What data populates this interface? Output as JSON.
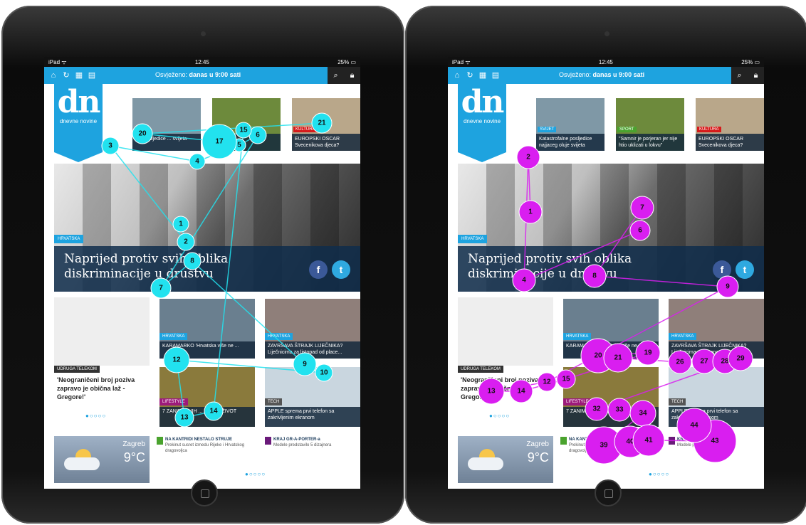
{
  "status_bar": {
    "device": "iPad ᯤ",
    "time": "12:45",
    "battery": "25% ▭"
  },
  "toolbar": {
    "refresh_prefix": "Osvježeno:",
    "refresh_value": "danas u 9:00 sati",
    "icons": [
      "home-icon",
      "refresh-icon",
      "grid-icon",
      "newspaper-icon",
      "search-icon",
      "lock-icon"
    ]
  },
  "logo": {
    "text": "dn",
    "subtitle": "dnevne novine"
  },
  "screen_left": {
    "top_thumbs": [
      {
        "tag": "",
        "caption": "...e posljedice ... svijeta"
      },
      {
        "tag": "",
        "caption": ""
      },
      {
        "tag": "KULTURA",
        "caption": "EUROPSKI OSCAR Svecenikova djeca?"
      }
    ]
  },
  "screen_right": {
    "top_thumbs": [
      {
        "tag": "SVIJET",
        "caption": "Katastrofalne posljedice najjaceg oluje svijeta"
      },
      {
        "tag": "SPORT",
        "caption": "\"Samnir je porjeran jer nije htio uklizati u lokvu\""
      },
      {
        "tag": "KULTURA",
        "caption": "EUROPSKI OSCAR Svecenikova djeca?"
      }
    ]
  },
  "hero": {
    "tag": "HRVATSKA",
    "title_line1": "Naprijed protiv svih oblika",
    "title_line2": "diskriminacije u društvu",
    "facebook": "f",
    "twitter": "t"
  },
  "cards": {
    "udruga": {
      "tag": "UDRUGA TELEKOM",
      "caption": "'Neograničeni broj poziva zapravo je obična laž - Gregore!'"
    },
    "karamarko": {
      "tag": "HRVATSKA",
      "caption": "KARAMARKO 'Hrvatska više ne ..."
    },
    "strajk": {
      "tag": "HRVATSKA",
      "caption": "ZAVRŠAVA ŠTRAJK LIJEČNIKA? Liječnicima za listopad od place..."
    },
    "lifestyle": {
      "tag": "LIFESTYLE",
      "caption": "7 ZANIMLJIVIH ... ZDRAV ŽIVOT"
    },
    "apple": {
      "tag": "TECH",
      "caption": "APPLE sprema prvi telefon sa zakrivljenim ekranom"
    }
  },
  "carousel_dots": "●○○○○",
  "page_dots": "●○○○○",
  "weather": {
    "city": "Zagreb",
    "temp": "9°C"
  },
  "news_list": [
    {
      "title": "NA KANTRIDI NESTALO STRUJE",
      "text": "Prekinut susret izmedu Rijeke i Hrvatskog dragovoljca"
    },
    {
      "title": "KRAJ GR-A-PORTER-a",
      "text": "Modele predstavilo 5 dizajnera"
    }
  ],
  "colors": {
    "accent": "#1ea3df",
    "fix_left": "#22e2ef",
    "fix_right": "#d91ef0",
    "tag_lifestyle": "#9c1a7a",
    "tag_kultura": "#d61a1a",
    "tag_sport": "#4aa32e",
    "tag_tech": "#555555"
  },
  "fixations_left": {
    "labels": [
      "1",
      "2",
      "3",
      "4",
      "5",
      "6",
      "7",
      "8",
      "9",
      "10",
      "12",
      "13",
      "14",
      "15",
      "17",
      "20",
      "21"
    ]
  },
  "fixations_right": {
    "labels": [
      "1",
      "2",
      "4",
      "6",
      "7",
      "8",
      "9",
      "12",
      "13",
      "14",
      "15",
      "19",
      "20",
      "21",
      "26",
      "27",
      "28",
      "29",
      "32",
      "33",
      "34",
      "39",
      "40",
      "41",
      "43",
      "44"
    ]
  }
}
